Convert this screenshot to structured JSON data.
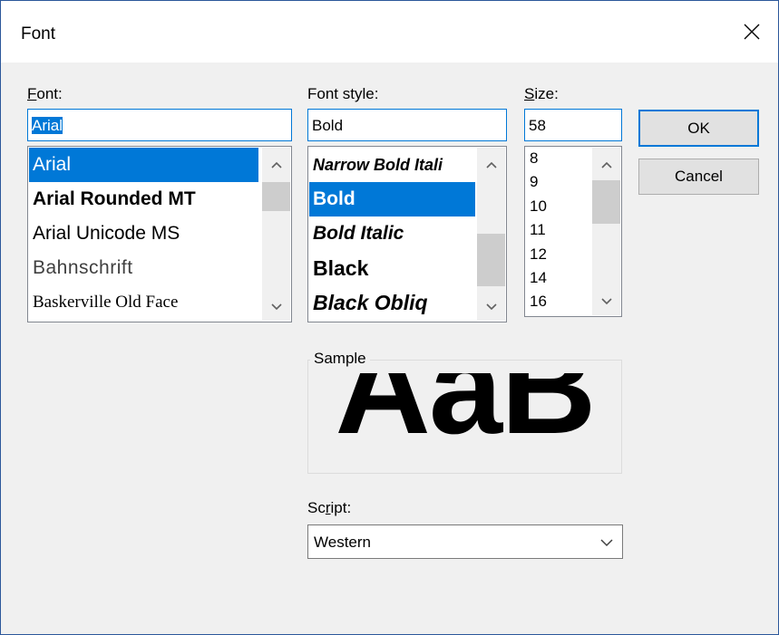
{
  "dialog": {
    "title": "Font"
  },
  "font": {
    "label_mnemonic": "F",
    "label_rest": "ont:",
    "value": "Arial",
    "items": [
      "Arial",
      "Arial Rounded MT",
      "Arial Unicode MS",
      "Bahnschrift",
      "Baskerville Old Face"
    ],
    "selected": "Arial"
  },
  "style": {
    "label": "Font style:",
    "value": "Bold",
    "items": [
      "Narrow Bold Itali",
      "Bold",
      "Bold Italic",
      "Black",
      "Black Obliq"
    ],
    "selected": "Bold"
  },
  "size": {
    "label_mnemonic": "S",
    "label_rest": "ize:",
    "value": "58",
    "items": [
      "8",
      "9",
      "10",
      "11",
      "12",
      "14",
      "16"
    ]
  },
  "buttons": {
    "ok": "OK",
    "cancel": "Cancel"
  },
  "sample": {
    "label": "Sample",
    "text": "AaB"
  },
  "script": {
    "label_before": "Sc",
    "label_mnemonic": "r",
    "label_after": "ipt:",
    "value": "Western"
  },
  "colors": {
    "accent": "#0078d7",
    "dialog_bg": "#f0f0f0",
    "title_bg": "#ffffff"
  },
  "icons": {
    "close": "close-icon",
    "scroll_up": "chevron-up-icon",
    "scroll_down": "chevron-down-icon",
    "dropdown": "chevron-down-icon"
  }
}
